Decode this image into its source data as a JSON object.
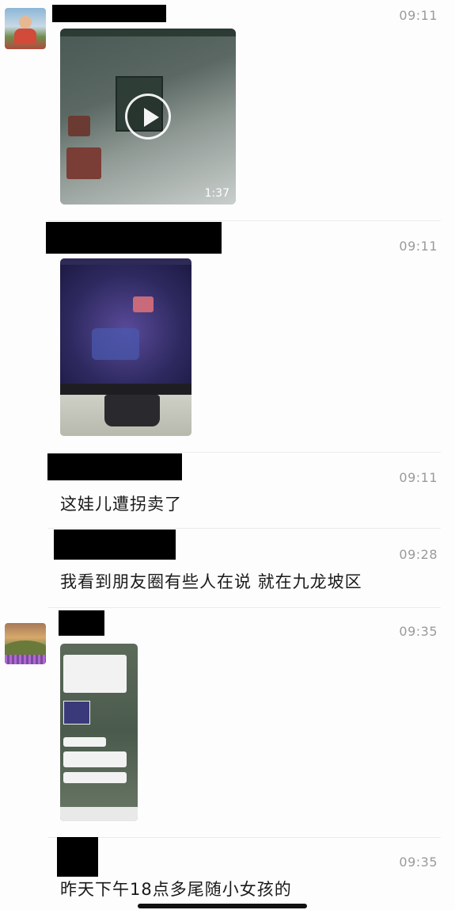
{
  "messages": [
    {
      "time": "09:11",
      "type": "video",
      "duration": "1:37"
    },
    {
      "time": "09:11",
      "type": "image"
    },
    {
      "time": "09:11",
      "type": "text",
      "text": "这娃儿遭拐卖了"
    },
    {
      "time": "09:28",
      "type": "text",
      "text": "我看到朋友圈有些人在说 就在九龙坡区"
    },
    {
      "time": "09:35",
      "type": "image"
    },
    {
      "time": "09:35",
      "type": "text",
      "text": "昨天下午18点多尾随小女孩的"
    }
  ]
}
